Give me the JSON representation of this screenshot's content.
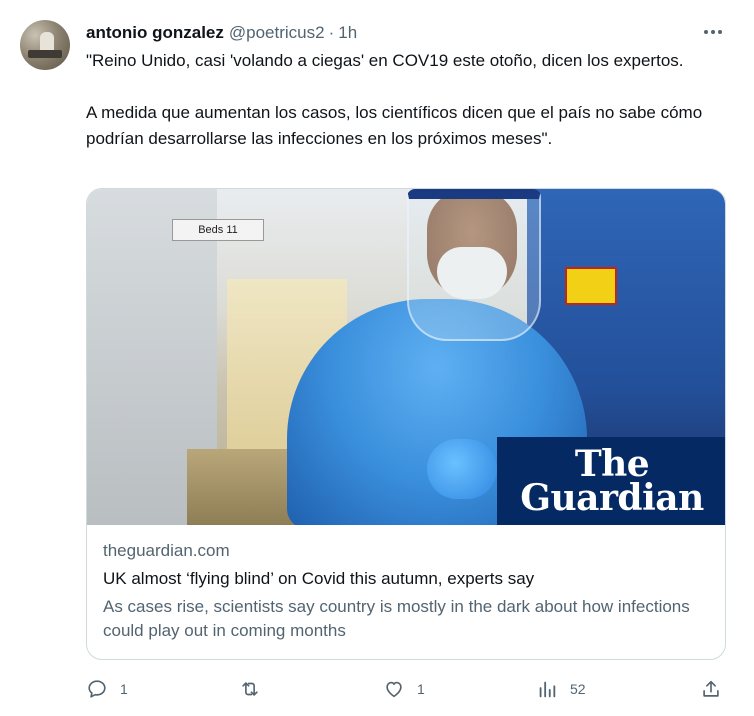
{
  "author": {
    "name": "antonio gonzalez",
    "handle": "@poetricus2",
    "separator": "·",
    "time": "1h"
  },
  "tweet": {
    "paragraphs": [
      "\"Reino Unido, casi 'volando a ciegas' en COV19 este otoño, dicen los expertos.",
      "A medida que aumentan los casos, los científicos dicen que el país no sabe cómo podrían desarrollarse las infecciones en los próximos meses\"."
    ]
  },
  "card": {
    "image_sign": "Beds 11",
    "brand_line1": "The",
    "brand_line2": "Guardian",
    "brand_color": "#052962",
    "domain": "theguardian.com",
    "title": "UK almost ‘flying blind’ on Covid this autumn, experts say",
    "description": "As cases rise, scientists say country is mostly in the dark about how infections could play out in coming months"
  },
  "actions": {
    "reply": {
      "icon": "reply-icon",
      "count": "1"
    },
    "retweet": {
      "icon": "retweet-icon",
      "count": ""
    },
    "like": {
      "icon": "heart-icon",
      "count": "1"
    },
    "views": {
      "icon": "views-icon",
      "count": "52"
    },
    "share": {
      "icon": "share-icon"
    }
  },
  "colors": {
    "text": "#0f1419",
    "muted": "#536471",
    "border": "#cfd9de"
  }
}
